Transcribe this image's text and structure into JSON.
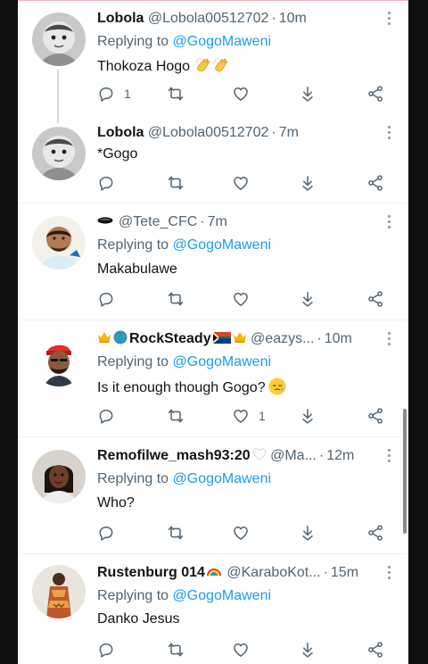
{
  "colors": {
    "link": "#1d9bf0",
    "text": "#0f1419",
    "secondary": "#536471",
    "background": "#ffffff"
  },
  "tweets": [
    {
      "name": "Lobola",
      "handle": "@Lobola00512702",
      "time": "10m",
      "reply_prefix": "Replying to",
      "reply_to": "@GogoMaweni",
      "text": "Thokoza Hogo",
      "text_emoji": "clapping-hands x2",
      "reply_count": "1",
      "like_count": "",
      "icons": [
        "reply-icon",
        "retweet-icon",
        "like-icon",
        "download-icon",
        "share-icon"
      ]
    },
    {
      "name": "Lobola",
      "handle": "@Lobola00512702",
      "time": "7m",
      "text": "*Gogo",
      "reply_count": "",
      "like_count": ""
    },
    {
      "name": "",
      "name_emoji": "black-disc",
      "handle": "@Tete_CFC",
      "time": "7m",
      "reply_prefix": "Replying to",
      "reply_to": "@GogoMaweni",
      "text": "Makabulawe",
      "reply_count": "",
      "like_count": ""
    },
    {
      "name": "RockSteady",
      "name_emoji": "crown globe south-africa-flag crown",
      "handle": "@eazys...",
      "time": "10m",
      "reply_prefix": "Replying to",
      "reply_to": "@GogoMaweni",
      "text": "Is it enough though Gogo?",
      "text_emoji": "relieved-face",
      "reply_count": "",
      "like_count": "1"
    },
    {
      "name": "Remofilwe_mash93:20",
      "name_emoji": "white-heart",
      "handle": "@Ma...",
      "time": "12m",
      "reply_prefix": "Replying to",
      "reply_to": "@GogoMaweni",
      "text": "Who?",
      "reply_count": "",
      "like_count": ""
    },
    {
      "name": "Rustenburg 014",
      "name_emoji": "rainbow",
      "handle": "@KaraboKot...",
      "time": "15m",
      "reply_prefix": "Replying to",
      "reply_to": "@GogoMaweni",
      "text": "Danko Jesus",
      "reply_count": "",
      "like_count": ""
    }
  ]
}
